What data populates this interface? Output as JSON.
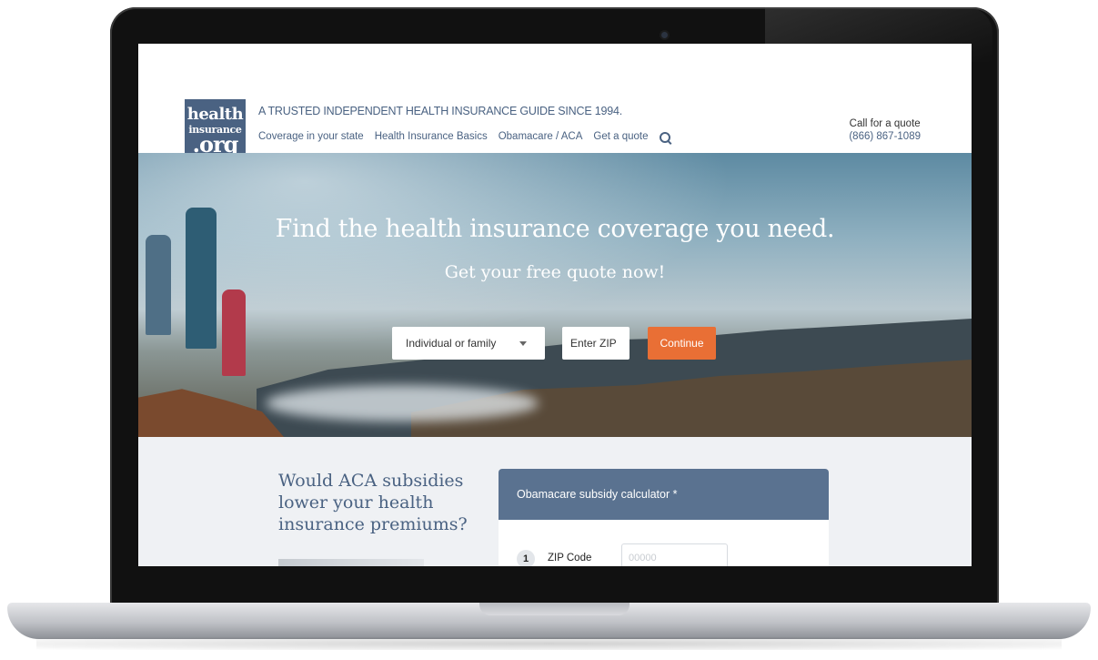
{
  "header": {
    "logo": {
      "line1": "health",
      "line2": "insurance",
      "line3": ".org"
    },
    "tagline": "A TRUSTED INDEPENDENT HEALTH INSURANCE GUIDE SINCE 1994.",
    "nav": {
      "coverage": "Coverage in your state",
      "basics": "Health Insurance Basics",
      "obamacare": "Obamacare / ACA",
      "quote": "Get a quote"
    },
    "call_label": "Call for a quote",
    "phone": "(866) 867-1089"
  },
  "hero": {
    "title": "Find the health insurance coverage you need.",
    "subtitle": "Get your free quote now!",
    "select_value": "Individual or family",
    "zip_placeholder": "Enter ZIP",
    "continue_label": "Continue"
  },
  "subsidy": {
    "question": "Would ACA subsidies lower your health insurance premiums?",
    "calculator_title": "Obamacare subsidy calculator *",
    "step_number": "1",
    "step_label": "ZIP Code",
    "zip_placeholder": "00000"
  },
  "colors": {
    "brand_blue": "#4a6282",
    "accent_orange": "#e96f35",
    "calc_header": "#5a7290"
  },
  "icons": [
    "search-icon"
  ]
}
